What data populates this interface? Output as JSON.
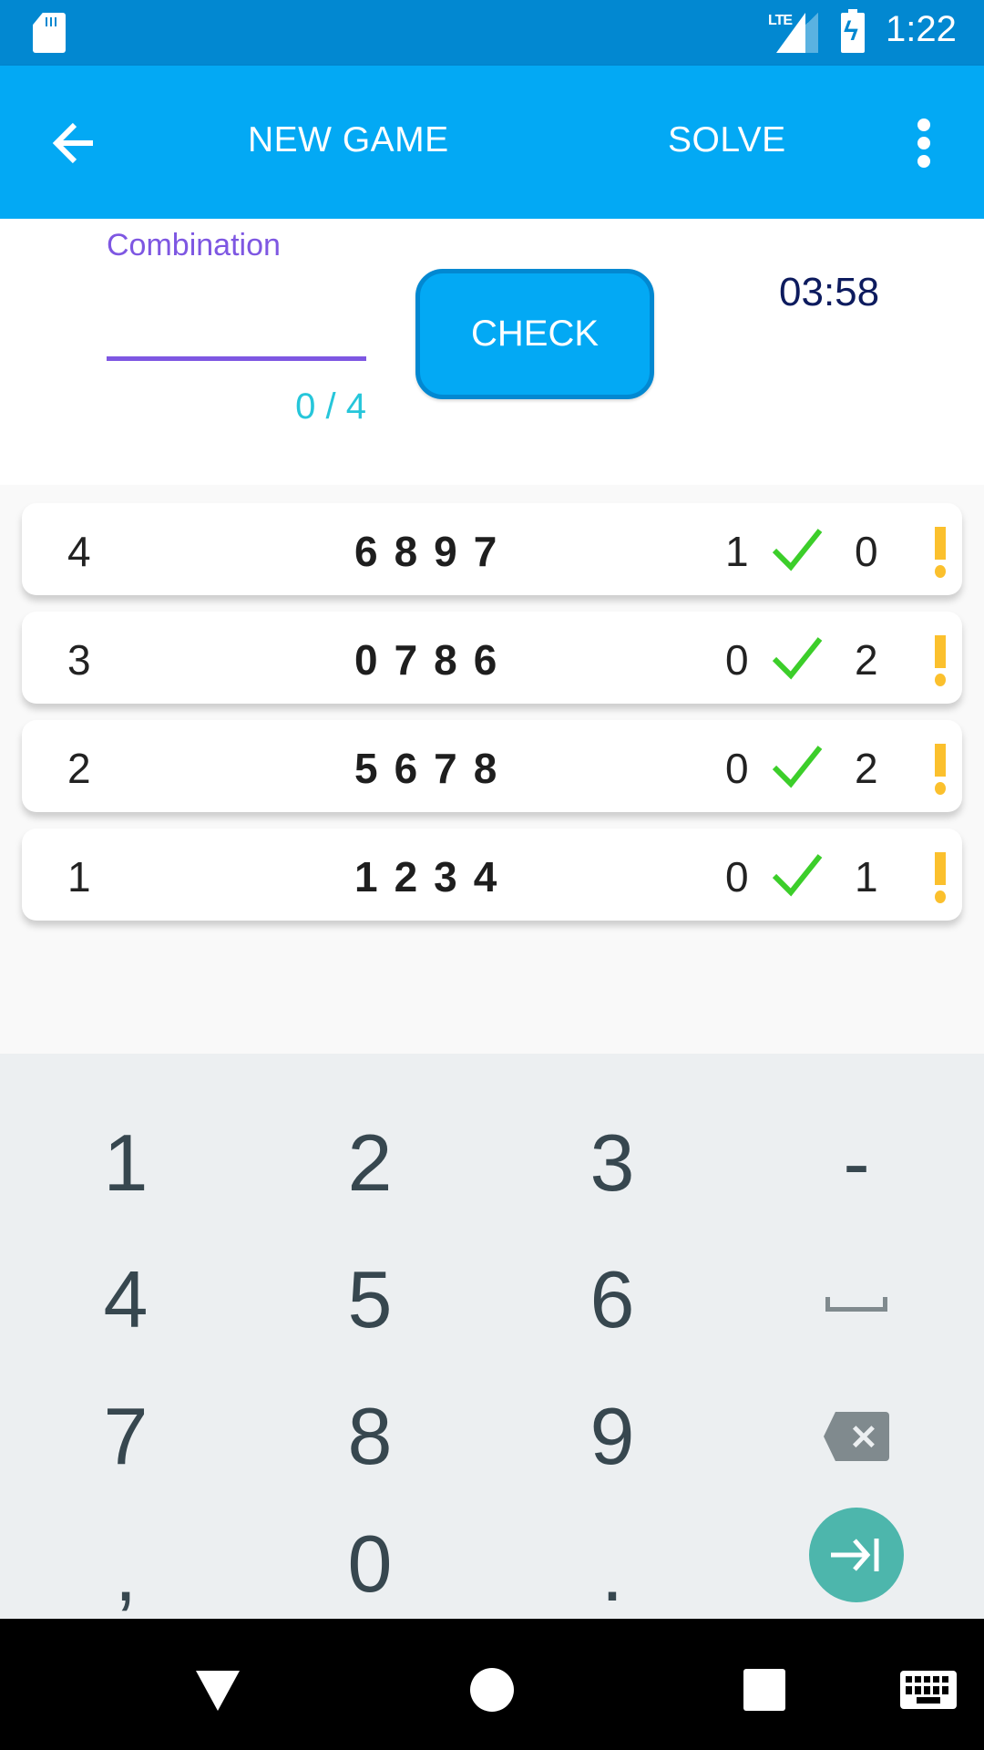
{
  "status_bar": {
    "network_label": "LTE",
    "time": "1:22",
    "icons": [
      "sd-card-icon",
      "signal-icon",
      "battery-charging-icon"
    ]
  },
  "app_bar": {
    "back_icon": "arrow-left-icon",
    "new_game_label": "NEW GAME",
    "solve_label": "SOLVE",
    "more_icon": "more-vert-icon"
  },
  "form": {
    "combination_label": "Combination",
    "combination_value": "",
    "counter": "0 / 4",
    "check_label": "CHECK",
    "timer": "03:58"
  },
  "guesses": [
    {
      "index": "4",
      "guess": "6897",
      "bulls": "1",
      "cows": "0"
    },
    {
      "index": "3",
      "guess": "0786",
      "bulls": "0",
      "cows": "2"
    },
    {
      "index": "2",
      "guess": "5678",
      "bulls": "0",
      "cows": "2"
    },
    {
      "index": "1",
      "guess": "1234",
      "bulls": "0",
      "cows": "1"
    }
  ],
  "keyboard": {
    "keys": [
      "1",
      "2",
      "3",
      "-",
      "4",
      "5",
      "6",
      "space",
      "7",
      "8",
      "9",
      "backspace",
      ",",
      "0",
      ".",
      "next"
    ]
  },
  "nav_bar": {
    "icons": [
      "back-triangle-icon",
      "home-circle-icon",
      "recents-square-icon",
      "keyboard-icon"
    ]
  },
  "colors": {
    "primary": "#03a9f4",
    "primary_dark": "#0288d1",
    "accent_purple": "#7e57e2",
    "counter_cyan": "#26c6da",
    "bulls_green": "#3cce2a",
    "cows_yellow": "#fbc02d",
    "enter_teal": "#4db6ac"
  }
}
